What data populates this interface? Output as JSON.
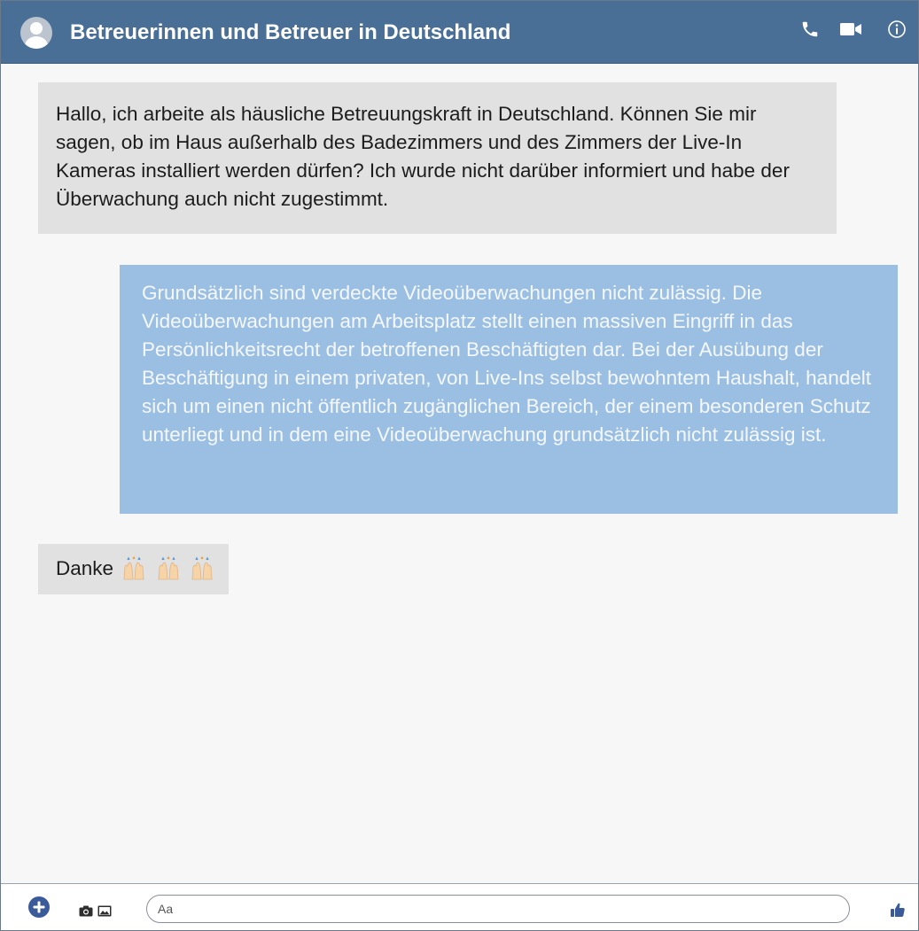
{
  "header": {
    "title": "Betreuerinnen und Betreuer in Deutschland",
    "icons": [
      "avatar-icon",
      "phone-icon",
      "video-icon",
      "info-icon"
    ]
  },
  "messages": [
    {
      "side": "left",
      "text": "Hallo, ich arbeite als häusliche Betreuungskraft in Deutschland. Können Sie mir sagen, ob im Haus außerhalb des Badezimmers und des Zimmers der Live-In Kameras installiert werden dürfen? Ich wurde nicht darüber informiert und habe der Überwachung auch nicht zugestimmt."
    },
    {
      "side": "right",
      "text": "Grundsätzlich sind verdeckte Videoüberwachungen nicht zulässig. Die Videoüberwachungen am Arbeitsplatz stellt einen massiven Eingriff in das Persönlichkeitsrecht der betroffenen Beschäftigten dar. Bei der Ausübung der Beschäftigung in einem privaten, von Live-Ins selbst bewohntem Haushalt, handelt sich um einen nicht öffentlich zugänglichen Bereich, der einem besonderen Schutz unterliegt und in dem eine Videoüberwachung grundsätzlich nicht zulässig ist."
    },
    {
      "side": "left",
      "text": "Danke",
      "emoji": [
        "raising-hands-emoji",
        "raising-hands-emoji",
        "raising-hands-emoji"
      ]
    }
  ],
  "composer": {
    "placeholder": "Aa",
    "icons": [
      "plus-icon",
      "camera-icon",
      "gallery-icon",
      "thumbs-up-icon"
    ]
  },
  "colors": {
    "header": "#4a6f96",
    "incoming_bubble": "#e1e1e1",
    "outgoing_bubble": "#9bbfe3",
    "accent": "#3b5a9a"
  }
}
